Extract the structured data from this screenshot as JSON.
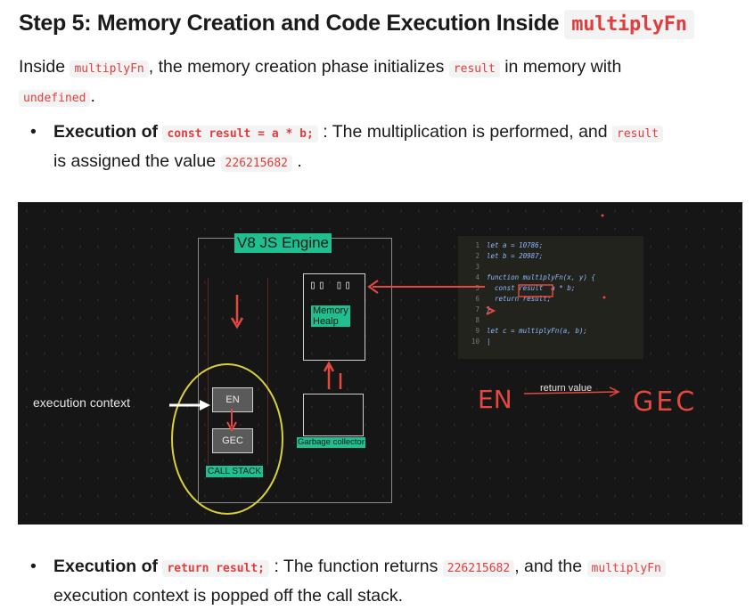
{
  "heading": {
    "text": "Step 5: Memory Creation and Code Execution Inside",
    "code": "multiplyFn"
  },
  "intro": {
    "t1": "Inside ",
    "c1": "multiplyFn",
    "t2": ", the memory creation phase initializes ",
    "c2": "result",
    "t3": " in memory with",
    "c3": "undefined",
    "t4": "."
  },
  "bullet1": {
    "bold": "Execution of",
    "code": "const result = a * b;",
    "t1": ": The multiplication is performed, and ",
    "code2": "result",
    "t2": "is assigned the value ",
    "code3": "226215682",
    "t3": "."
  },
  "figure": {
    "engine_title": "V8 JS Engine",
    "memory_heap": "Memory\nHealp",
    "garbage_collector": "Garbage collector",
    "call_stack": "CALL STACK",
    "stack_top": "EN",
    "stack_bottom": "GEC",
    "execution_context": "execution context",
    "editor_lines": [
      {
        "n": "1",
        "code": "let a = 10786;"
      },
      {
        "n": "2",
        "code": "let b = 20987;"
      },
      {
        "n": "3",
        "code": ""
      },
      {
        "n": "4",
        "code": "function multiplyFn(x, y) {"
      },
      {
        "n": "5",
        "code": "  const result  a * b;"
      },
      {
        "n": "6",
        "code": "  return result;"
      },
      {
        "n": "7",
        "code": "}"
      },
      {
        "n": "8",
        "code": ""
      },
      {
        "n": "9",
        "code": "let c = multiplyFn(a, b);"
      },
      {
        "n": "10",
        "code": "|"
      }
    ],
    "handwritten_en": "EN",
    "return_value": "return value",
    "handwritten_gec": "GEC",
    "colors": {
      "accent_red": "#e5483f",
      "label_green": "#1fbf8f",
      "yellow": "#d9cf3a"
    }
  },
  "bullet2": {
    "bold": "Execution of",
    "code": "return result;",
    "t1": ": The function returns ",
    "code2": "226215682",
    "t2": ", and the ",
    "code3": "multiplyFn",
    "t3": "execution context is popped off the call stack."
  }
}
